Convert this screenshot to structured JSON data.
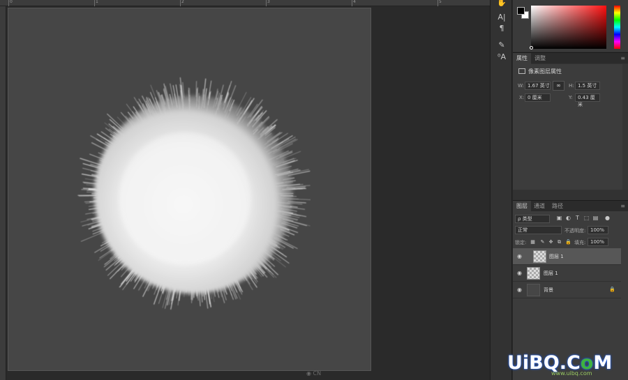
{
  "ruler": {
    "numbers": [
      "0",
      "1",
      "2",
      "3",
      "4",
      "5"
    ]
  },
  "canvas": {
    "footer_mark": "CN"
  },
  "tools": {
    "items": [
      {
        "name": "hand-tool-icon",
        "glyph": "✋"
      },
      {
        "name": "character-icon",
        "glyph": "A|"
      },
      {
        "name": "paragraph-icon",
        "glyph": "¶"
      },
      {
        "name": "brush-presets-icon",
        "glyph": "✎"
      },
      {
        "name": "glyphs-icon",
        "glyph": "⁰A"
      }
    ]
  },
  "colors": {
    "foreground": "#000000",
    "background": "#ffffff",
    "picker_hue": "#ff1010"
  },
  "properties": {
    "tabs": [
      "属性",
      "调整"
    ],
    "title": "像素图层属性",
    "w_label": "W:",
    "w_value": "1.67 英寸",
    "h_label": "H:",
    "h_value": "1.5 英寸",
    "x_label": "X:",
    "x_value": "0 厘米",
    "y_label": "Y:",
    "y_value": "0.43 厘米",
    "link_glyph": "∞"
  },
  "layers": {
    "tabs": [
      "图层",
      "通道",
      "路径"
    ],
    "filter_label": "ρ 类型",
    "blend_mode": "正常",
    "opacity_label": "不透明度:",
    "opacity_value": "100%",
    "lock_label": "锁定:",
    "fill_label": "填充:",
    "fill_value": "100%",
    "rows": [
      {
        "name": "图层 1",
        "selected": true
      },
      {
        "name": "图层 1",
        "selected": false
      },
      {
        "name": "背景",
        "selected": false
      }
    ]
  },
  "watermark": {
    "text_u": "UiBQ.C",
    "text_o": "o",
    "text_m": "M",
    "sub": "www.uibq.com"
  }
}
